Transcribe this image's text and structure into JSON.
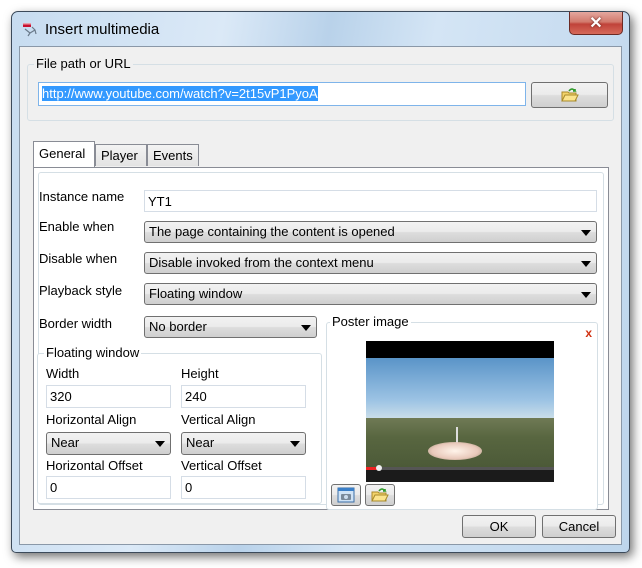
{
  "window": {
    "title": "Insert multimedia",
    "close_label": "✕"
  },
  "file_path": {
    "group_label": "File path or URL",
    "value": "http://www.youtube.com/watch?v=2t15vP1PyoA",
    "browse_icon": "folder-open-icon"
  },
  "tabs": [
    {
      "label": "General",
      "active": true
    },
    {
      "label": "Player",
      "active": false
    },
    {
      "label": "Events",
      "active": false
    }
  ],
  "general": {
    "instance_name": {
      "label": "Instance name",
      "value": "YT1"
    },
    "enable_when": {
      "label": "Enable when",
      "value": "The page containing the content is opened"
    },
    "disable_when": {
      "label": "Disable when",
      "value": "Disable invoked from the context menu"
    },
    "playback_style": {
      "label": "Playback style",
      "value": "Floating window"
    },
    "border_width": {
      "label": "Border width",
      "value": "No border"
    }
  },
  "floating_window": {
    "group_label": "Floating window",
    "width": {
      "label": "Width",
      "value": "320"
    },
    "height": {
      "label": "Height",
      "value": "240"
    },
    "horizontal_align": {
      "label": "Horizontal Align",
      "value": "Near"
    },
    "vertical_align": {
      "label": "Vertical Align",
      "value": "Near"
    },
    "horizontal_offset": {
      "label": "Horizontal Offset",
      "value": "0"
    },
    "vertical_offset": {
      "label": "Vertical Offset",
      "value": "0"
    }
  },
  "poster": {
    "group_label": "Poster image",
    "remove_icon": "x",
    "capture_icon": "camera-icon",
    "browse_icon": "folder-open-icon",
    "video_progress": 0.07
  },
  "footer": {
    "ok_label": "OK",
    "cancel_label": "Cancel"
  }
}
